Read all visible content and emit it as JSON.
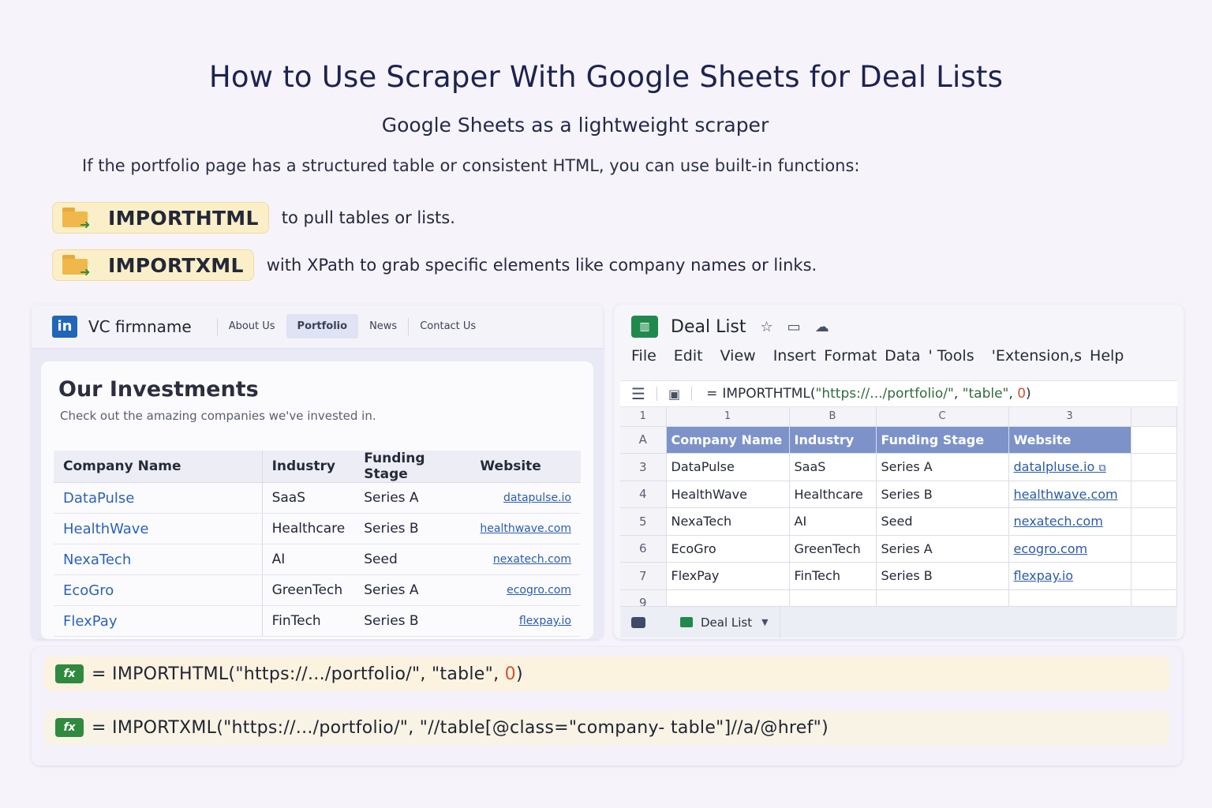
{
  "header": {
    "title": "How to Use Scraper With Google Sheets for Deal Lists",
    "subtitle": "Google Sheets as a lightweight scraper",
    "intro": "If the portfolio page has a structured table or consistent HTML, you can use built-in functions:"
  },
  "functions": [
    {
      "name": "IMPORTHTML",
      "desc": "to pull tables or lists.",
      "icon": "folder-arrow-icon"
    },
    {
      "name": "IMPORTXML",
      "desc": "with XPath to grab specific elements like company names or links.",
      "icon": "folder-arrow-icon"
    }
  ],
  "website": {
    "logo": "in",
    "firm_name": "VC firmname",
    "nav": [
      "About Us",
      "Portfolio",
      "News",
      "Contact Us"
    ],
    "active_nav": "Portfolio",
    "heading": "Our Investments",
    "subheading": "Check out the amazing companies we've invested in.",
    "columns": [
      "Company Name",
      "Industry",
      "Funding Stage",
      "Website"
    ],
    "rows": [
      [
        "DataPulse",
        "SaaS",
        "Series A",
        "datapulse.io"
      ],
      [
        "HealthWave",
        "Healthcare",
        "Series B",
        "healthwave.com"
      ],
      [
        "NexaTech",
        "AI",
        "Seed",
        "nexatech.com"
      ],
      [
        "EcoGro",
        "GreenTech",
        "Series A",
        "ecogro.com"
      ],
      [
        "FlexPay",
        "FinTech",
        "Series B",
        "flexpay.io"
      ]
    ]
  },
  "sheet": {
    "doc_title": "Deal List",
    "menu": [
      "File",
      "Edit",
      "View",
      "Insert",
      "Format",
      "Data",
      "' Tools",
      "'Extension,s",
      "Help"
    ],
    "formula_bar": {
      "eq": "=",
      "fn": "IMPORTHTML(",
      "arg1": "\"https://.../portfolio/\"",
      "arg2": "\"table\"",
      "arg3": "0",
      "close": ")"
    },
    "col_headers": [
      "1",
      "1",
      "B",
      "C",
      "3"
    ],
    "row_labels": [
      "A",
      "3",
      "4",
      "5",
      "6",
      "7",
      "9"
    ],
    "header_row": [
      "Company Name",
      "Industry",
      "Funding Stage",
      "Website"
    ],
    "rows": [
      [
        "DataPulse",
        "SaaS",
        "Series A",
        "datalpluse.io"
      ],
      [
        "HealthWave",
        "Healthcare",
        "Series B",
        "healthwave.com"
      ],
      [
        "NexaTech",
        "AI",
        "Seed",
        "nexatech.com"
      ],
      [
        "EcoGro",
        "GreenTech",
        "Series A",
        "ecogro.com"
      ],
      [
        "FlexPay",
        "FinTech",
        "Series B",
        "flexpay.io"
      ]
    ],
    "sheet_tab": "Deal List",
    "accent": "#7d92c8"
  },
  "formulas": {
    "importhtml": {
      "eq": "= ",
      "fn": "IMPORTHTML(",
      "a1": "\"https://.../portfolio/\"",
      "sep1": ",  ",
      "a2": "\"table\"",
      "sep2": ",  ",
      "a3": "0",
      "close": ")"
    },
    "importxml": {
      "eq": "= ",
      "fn": "IMPORTXML(",
      "a1": "\"https://.../portfolio/\"",
      "sep1": ",  ",
      "a2": "\"//table[@class=\"company- table\"]//a/@href\"",
      "close": ")"
    },
    "fx_label": "fx"
  },
  "colors": {
    "brand_linkedin": "#2266b8",
    "sheets_green": "#1f8a4c",
    "link": "#2c62b8"
  }
}
